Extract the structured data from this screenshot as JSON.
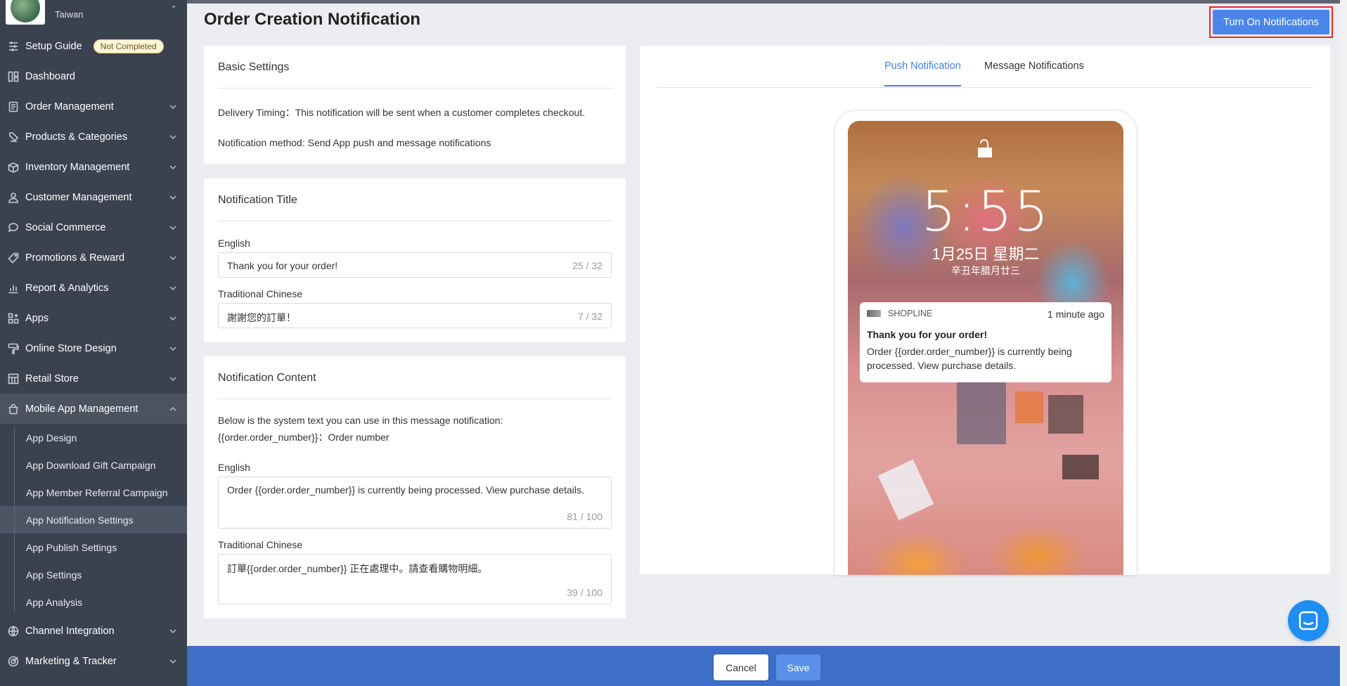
{
  "sidebar": {
    "store_name": "",
    "store_region": "Taiwan",
    "items": [
      {
        "label": "Setup Guide",
        "badge": "Not Completed",
        "icon": "setup-icon"
      },
      {
        "label": "Dashboard",
        "icon": "dashboard-icon"
      },
      {
        "label": "Order Management",
        "icon": "order-icon"
      },
      {
        "label": "Products & Categories",
        "icon": "tag-icon"
      },
      {
        "label": "Inventory Management",
        "icon": "box-icon"
      },
      {
        "label": "Customer Management",
        "icon": "user-icon"
      },
      {
        "label": "Social Commerce",
        "icon": "chat-icon"
      },
      {
        "label": "Promotions & Reward",
        "icon": "promo-tag-icon"
      },
      {
        "label": "Report & Analytics",
        "icon": "chart-icon"
      },
      {
        "label": "Apps",
        "icon": "apps-icon"
      },
      {
        "label": "Online Store Design",
        "icon": "brush-icon"
      },
      {
        "label": "Retail Store",
        "icon": "store-icon"
      },
      {
        "label": "Mobile App Management",
        "icon": "bag-icon"
      }
    ],
    "sub_items": [
      {
        "label": "App Design"
      },
      {
        "label": "App Download Gift Campaign"
      },
      {
        "label": "App Member Referral Campaign"
      },
      {
        "label": "App Notification Settings"
      },
      {
        "label": "App Publish Settings"
      },
      {
        "label": "App Settings"
      },
      {
        "label": "App Analysis"
      }
    ],
    "bottom_items": [
      {
        "label": "Channel Integration",
        "icon": "globe-icon"
      },
      {
        "label": "Marketing & Tracker",
        "icon": "target-icon"
      }
    ]
  },
  "header": {
    "breadcrumb": "",
    "title": "Order Creation Notification",
    "turn_on_label": "Turn On Notifications"
  },
  "basic_settings": {
    "title": "Basic Settings",
    "delivery_timing": "Delivery Timing：This notification will be sent when a customer completes checkout.",
    "method": "Notification method: Send App push and message notifications"
  },
  "notification_title": {
    "title": "Notification Title",
    "english_label": "English",
    "english_value": "Thank you for your order!",
    "english_count": "25 / 32",
    "chinese_label": "Traditional Chinese",
    "chinese_value": "謝謝您的訂單！",
    "chinese_count": "7 / 32"
  },
  "notification_content": {
    "title": "Notification Content",
    "intro": "Below is the system text you can use in this message notification:",
    "variable": "{{order.order_number}}：Order number",
    "english_label": "English",
    "english_value": "Order {{order.order_number}} is currently being processed. View purchase details.",
    "english_count": "81 / 100",
    "chinese_label": "Traditional Chinese",
    "chinese_value": "訂單{{order.order_number}} 正在處理中。請查看購物明細。",
    "chinese_count": "39 / 100"
  },
  "preview": {
    "tabs": [
      {
        "label": "Push Notification",
        "active": true
      },
      {
        "label": "Message Notifications",
        "active": false
      }
    ],
    "time": "5:55",
    "date": "1月25日 星期二",
    "lunar_date": "辛丑年腊月廿三",
    "notification": {
      "app_name": "SHOPLINE",
      "time_ago": "1 minute ago",
      "title": "Thank you for your order!",
      "body": "Order {{order.order_number}} is currently being processed. View purchase details."
    }
  },
  "footer": {
    "cancel_label": "Cancel",
    "save_label": "Save"
  },
  "colors": {
    "primary": "#4a86e8",
    "sidebar": "#3a4250",
    "footer": "#3d6fc6",
    "highlight_border": "#e6262c"
  }
}
